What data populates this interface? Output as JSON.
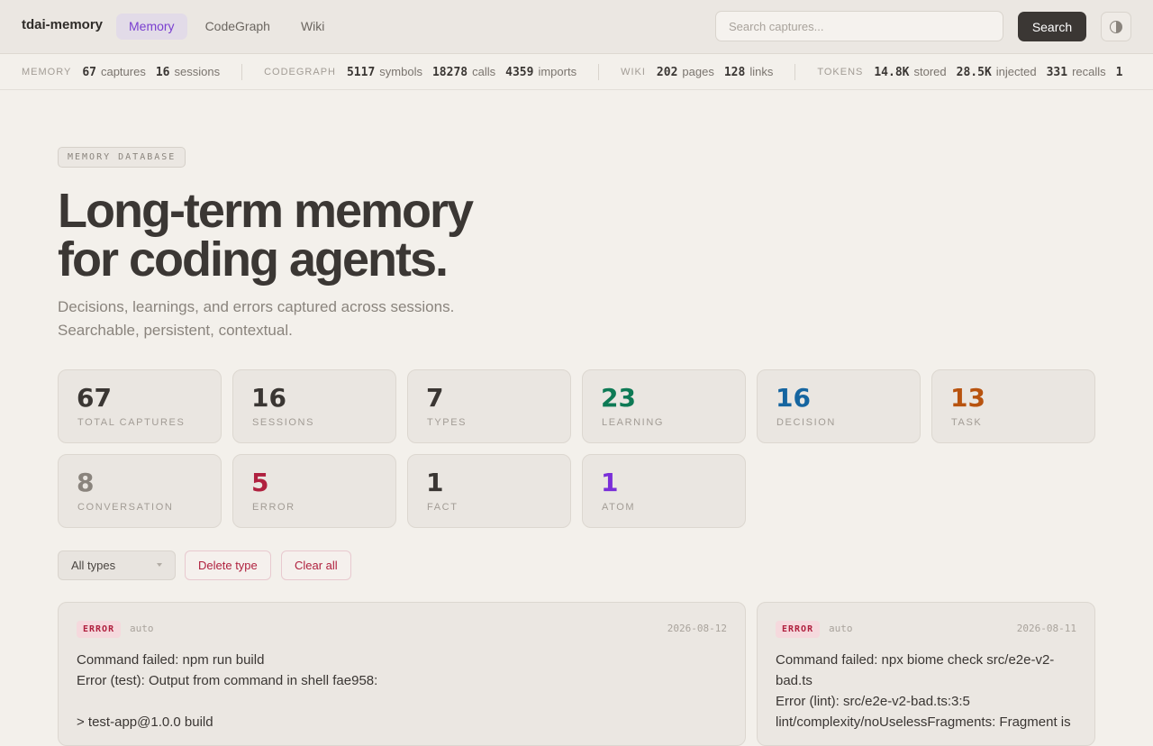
{
  "nav": {
    "brand": "tdai-memory",
    "tabs": [
      {
        "label": "Memory",
        "active": true
      },
      {
        "label": "CodeGraph",
        "active": false
      },
      {
        "label": "Wiki",
        "active": false
      }
    ],
    "search_placeholder": "Search captures...",
    "search_button": "Search",
    "theme_icon": "contrast-icon"
  },
  "strip": {
    "memory": {
      "label": "MEMORY",
      "captures": "67",
      "captures_unit": "captures",
      "sessions": "16",
      "sessions_unit": "sessions"
    },
    "codegraph": {
      "label": "CODEGRAPH",
      "symbols": "5117",
      "symbols_unit": "symbols",
      "calls": "18278",
      "calls_unit": "calls",
      "imports": "4359",
      "imports_unit": "imports"
    },
    "wiki": {
      "label": "WIKI",
      "pages": "202",
      "pages_unit": "pages",
      "links": "128",
      "links_unit": "links"
    },
    "tokens": {
      "label": "TOKENS",
      "stored": "14.8K",
      "stored_unit": "stored",
      "injected": "28.5K",
      "injected_unit": "injected",
      "recalls": "331",
      "recalls_unit": "recalls",
      "overflow": "1"
    }
  },
  "hero": {
    "badge": "MEMORY DATABASE",
    "title_line1": "Long-term memory",
    "title_line2": "for coding agents.",
    "sub_line1": "Decisions, learnings, and errors captured across sessions.",
    "sub_line2": "Searchable, persistent, contextual."
  },
  "stats": [
    {
      "value": "67",
      "label": "TOTAL CAPTURES",
      "color": "#3a3633"
    },
    {
      "value": "16",
      "label": "SESSIONS",
      "color": "#3a3633"
    },
    {
      "value": "7",
      "label": "TYPES",
      "color": "#3a3633"
    },
    {
      "value": "23",
      "label": "LEARNING",
      "color": "#0e7a55"
    },
    {
      "value": "16",
      "label": "DECISION",
      "color": "#1565a0"
    },
    {
      "value": "13",
      "label": "TASK",
      "color": "#b8530f"
    },
    {
      "value": "8",
      "label": "CONVERSATION",
      "color": "#8a847d"
    },
    {
      "value": "5",
      "label": "ERROR",
      "color": "#b0213f"
    },
    {
      "value": "1",
      "label": "FACT",
      "color": "#3a3633"
    },
    {
      "value": "1",
      "label": "ATOM",
      "color": "#7a2fd8"
    }
  ],
  "filters": {
    "type_select": "All types",
    "delete_type": "Delete type",
    "clear_all": "Clear all"
  },
  "captures": [
    {
      "type": "ERROR",
      "source": "auto",
      "date": "2026-08-12",
      "body": "Command failed: npm run build\nError (test): Output from command in shell fae958:\n\n> test-app@1.0.0 build"
    },
    {
      "type": "ERROR",
      "source": "auto",
      "date": "2026-08-11",
      "body": "Command failed: npx biome check src/e2e-v2-\nbad.ts\nError (lint): src/e2e-v2-bad.ts:3:5\nlint/complexity/noUselessFragments: Fragment is"
    }
  ]
}
